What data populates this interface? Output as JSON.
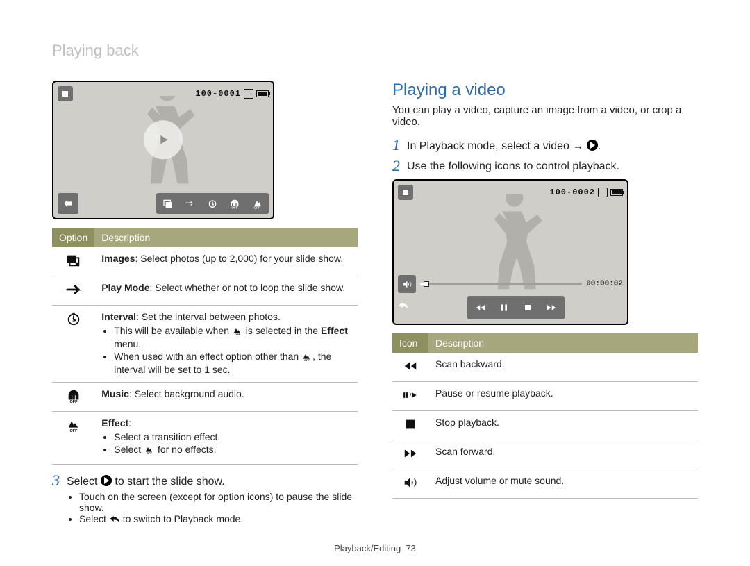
{
  "page": {
    "header": "Playing back",
    "footer_section": "Playback/Editing",
    "footer_page": "73"
  },
  "left_lcd": {
    "file_label": "100-0001"
  },
  "right_lcd": {
    "file_label": "100-0002",
    "time": "00:00:02"
  },
  "options_table": {
    "headers": {
      "option": "Option",
      "description": "Description"
    },
    "rows": {
      "images": {
        "title": "Images",
        "text": ": Select photos (up to 2,000) for your slide show."
      },
      "playmode": {
        "title": "Play Mode",
        "text": ": Select whether or not to loop the slide show."
      },
      "interval": {
        "title": "Interval",
        "text": ": Set the interval between photos.",
        "b1a": "This will be available when ",
        "b1b": " is selected in the ",
        "b1c": "Effect",
        "b1d": " menu.",
        "b2a": "When used with an effect option other than ",
        "b2b": ", the interval will be set to 1 sec."
      },
      "music": {
        "title": "Music",
        "text": ": Select background audio."
      },
      "effect": {
        "title": "Effect",
        "text": ":",
        "b1": "Select a transition effect.",
        "b2a": "Select ",
        "b2b": " for no effects."
      }
    }
  },
  "step3": {
    "num": "3",
    "a": "Select ",
    "b": " to start the slide show.",
    "bullet1": "Touch on the screen (except for option icons) to pause the slide show.",
    "bullet2a": "Select ",
    "bullet2b": " to switch to Playback mode."
  },
  "playing_video": {
    "title": "Playing a video",
    "lead": "You can play a video, capture an image from a video, or crop a video.",
    "step1": {
      "num": "1",
      "a": "In Playback mode, select a video → ",
      "end": "."
    },
    "step2": {
      "num": "2",
      "text": "Use the following icons to control playback."
    }
  },
  "icons_table": {
    "headers": {
      "icon": "Icon",
      "description": "Description"
    },
    "rows": {
      "rew": "Scan backward.",
      "pause": "Pause or resume playback.",
      "stop": "Stop playback.",
      "ffw": "Scan forward.",
      "vol": "Adjust volume or mute sound."
    }
  }
}
